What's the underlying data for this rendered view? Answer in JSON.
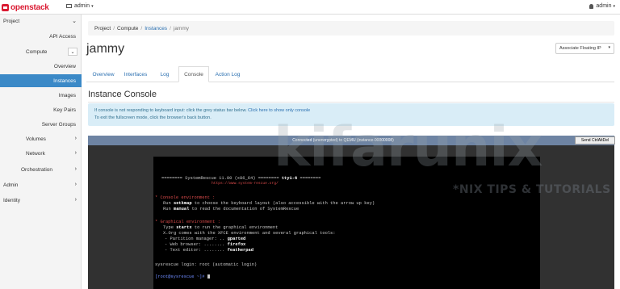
{
  "brand": {
    "name": "openstack"
  },
  "topbar": {
    "project_label": "admin",
    "user_label": "admin"
  },
  "sidebar": {
    "items": [
      {
        "label": "Project"
      },
      {
        "label": "API Access"
      },
      {
        "label": "Compute"
      },
      {
        "label": "Overview"
      },
      {
        "label": "Instances"
      },
      {
        "label": "Images"
      },
      {
        "label": "Key Pairs"
      },
      {
        "label": "Server Groups"
      },
      {
        "label": "Volumes"
      },
      {
        "label": "Network"
      },
      {
        "label": "Orchestration"
      },
      {
        "label": "Admin"
      },
      {
        "label": "Identity"
      }
    ]
  },
  "breadcrumb": {
    "items": [
      "Project",
      "Compute",
      "Instances",
      "jammy"
    ]
  },
  "page": {
    "title": "jammy",
    "associate_button": "Associate Floating IP",
    "section_title": "Instance Console"
  },
  "tabs": [
    {
      "label": "Overview"
    },
    {
      "label": "Interfaces"
    },
    {
      "label": "Log"
    },
    {
      "label": "Console"
    },
    {
      "label": "Action Log"
    }
  ],
  "info": {
    "line1": "If console is not responding to keyboard input: click the grey status bar below.",
    "link": "Click here to show only console",
    "line2": "To exit the fullscreen mode, click the browser's back button."
  },
  "vnc": {
    "status": "Connected (unencrypted) to QEMU (instance-00000008)",
    "send_cad": "Send CtrlAltDel"
  },
  "console": {
    "line_banner_left": "======== SystemRescue 11.00 (x86_64) ======== ",
    "line_banner_tty": "tty1-6",
    "line_banner_right": " ========",
    "url": "https://www.system-rescue.org/",
    "env_heading": "* Console environment :",
    "setkmap_prefix": "Run ",
    "setkmap_cmd": "setkmap",
    "setkmap_rest": " to choose the keyboard layout (also accessible with the arrow up key)",
    "manual_prefix": "Run ",
    "manual_cmd": "manual",
    "manual_rest": " to read the documentation of SystemRescue",
    "gfx_heading": "* Graphical environment :",
    "startx_prefix": "Type ",
    "startx_cmd": "startx",
    "startx_rest": " to run the graphical environment",
    "xorg": "X.Org comes with the XFCE environment and several graphical tools:",
    "pm_label": "- Partition manager: .. ",
    "pm_value": "gparted",
    "wb_label": "- Web browser: ........ ",
    "wb_value": "firefox",
    "te_label": "- Text editor: ........ ",
    "te_value": "featherpad",
    "login": "sysrescue login: root (automatic login)",
    "prompt_user": "[root@sysrescue ~]#",
    "prompt_cursor": " "
  },
  "watermark": {
    "text": "kifarunix",
    "tagline": "*NIX TIPS & TUTORIALS"
  },
  "colors": {
    "accent": "#3b89c7",
    "brand": "#da1a32",
    "vnc_bar": "#6e84a3"
  },
  "icons": [
    "project-icon",
    "user-icon",
    "chevron-down-icon",
    "chevron-right-icon",
    "caret-down-icon"
  ]
}
